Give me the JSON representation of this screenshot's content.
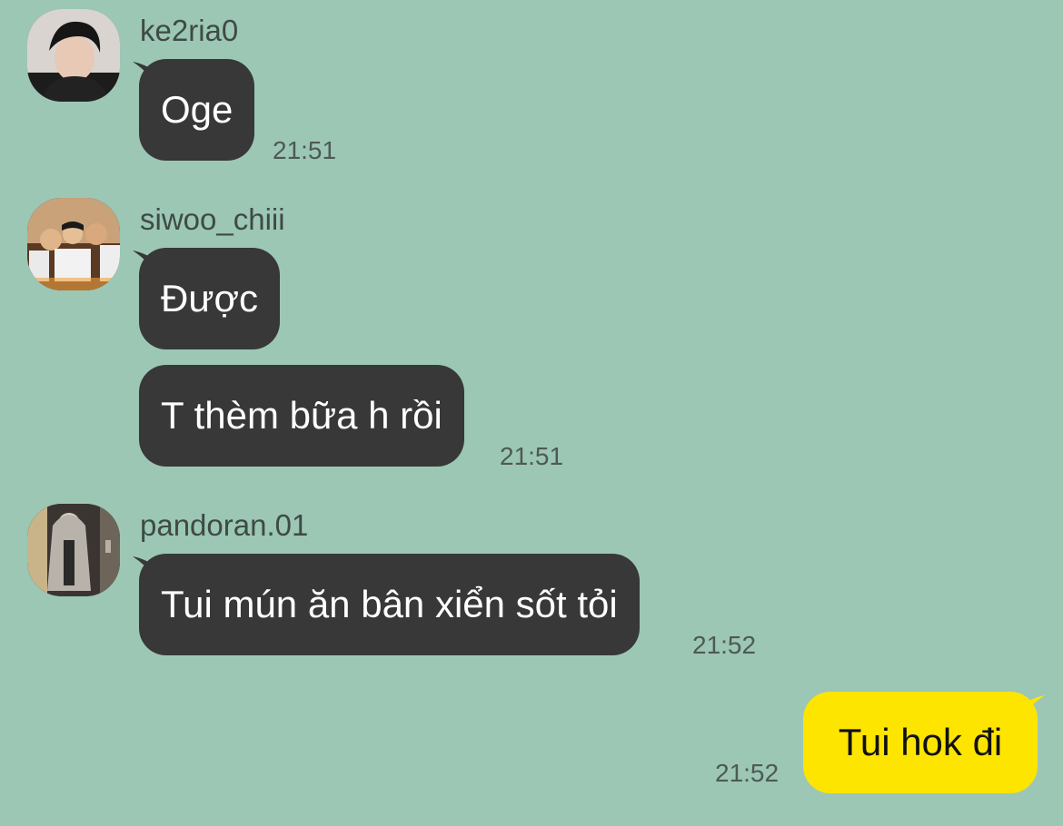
{
  "colors": {
    "background": "#9cc7b5",
    "incoming_bubble": "#383838",
    "outgoing_bubble": "#fee500",
    "username_text": "#3f4a46",
    "time_text": "#4e5955"
  },
  "messages": [
    {
      "sender": "ke2ria0",
      "avatar_icon": "profile-photo-icon",
      "bubbles": [
        {
          "text": "Oge",
          "time": "21:51"
        }
      ]
    },
    {
      "sender": "siwoo_chiii",
      "avatar_icon": "profile-photo-icon",
      "bubbles": [
        {
          "text": "Được",
          "time": ""
        },
        {
          "text": "T thèm bữa h rồi",
          "time": "21:51"
        }
      ]
    },
    {
      "sender": "pandoran.01",
      "avatar_icon": "profile-photo-icon",
      "bubbles": [
        {
          "text": "Tui mún ăn bân xiển sốt tỏi",
          "time": "21:52"
        }
      ]
    },
    {
      "sender": "",
      "outgoing": true,
      "bubbles": [
        {
          "text": "Tui hok đi",
          "time": "21:52"
        }
      ]
    }
  ]
}
